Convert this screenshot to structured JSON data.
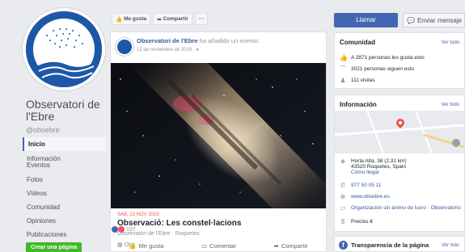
{
  "left": {
    "page_name_line1": "Observatori de",
    "page_name_line2": "l'Ebre",
    "handle": "@obsebre",
    "nav": [
      "Inicio",
      "Información",
      "Eventos",
      "Fotos",
      "Vídeos",
      "Comunidad",
      "Opiniones",
      "Publicaciones"
    ],
    "create_page": "Crear una página"
  },
  "actionbar": {
    "like": "Me gusta",
    "share": "Compartir",
    "more": "···"
  },
  "post": {
    "author": "Observatori de l'Ebre",
    "action": " ha añadido un evento.",
    "date": "12 de noviembre de 2019 · ",
    "event_date": "SAB, 23 NOV 2019",
    "event_title": "Observació: Les constel·lacions",
    "event_sub": "Observatori de l'Ebre · Roquetes",
    "event_type": "Otro",
    "reaction_count": "107",
    "actions": {
      "like": "Me gusta",
      "comment": "Comentar",
      "share": "Compartir"
    }
  },
  "right": {
    "call": "Llamar",
    "message": "Enviar mensaje",
    "community": {
      "title": "Comunidad",
      "see_all": "Ver todo",
      "likes": "A 2871 personas les gusta esto",
      "follows": "3021 personas siguen esto",
      "visits": "111 visitas"
    },
    "info": {
      "title": "Información",
      "see_all": "Ver todo",
      "address1": "Horta Alta, 38 (2,31 km)",
      "address2": "43520 Roquetes, Spain",
      "directions": "Cómo llegar",
      "phone": "977 50 05 11",
      "website": "www.obsebre.es",
      "category": "Organización sin ánimo de lucro · Observatorio",
      "price": "Precios €"
    },
    "transparency": {
      "title": "Transparencia de la página",
      "see_more": "Ver más"
    }
  },
  "colors": {
    "brand_blue": "#4267b2",
    "link": "#365899",
    "green": "#42b72a",
    "event_red": "#e9564b"
  }
}
